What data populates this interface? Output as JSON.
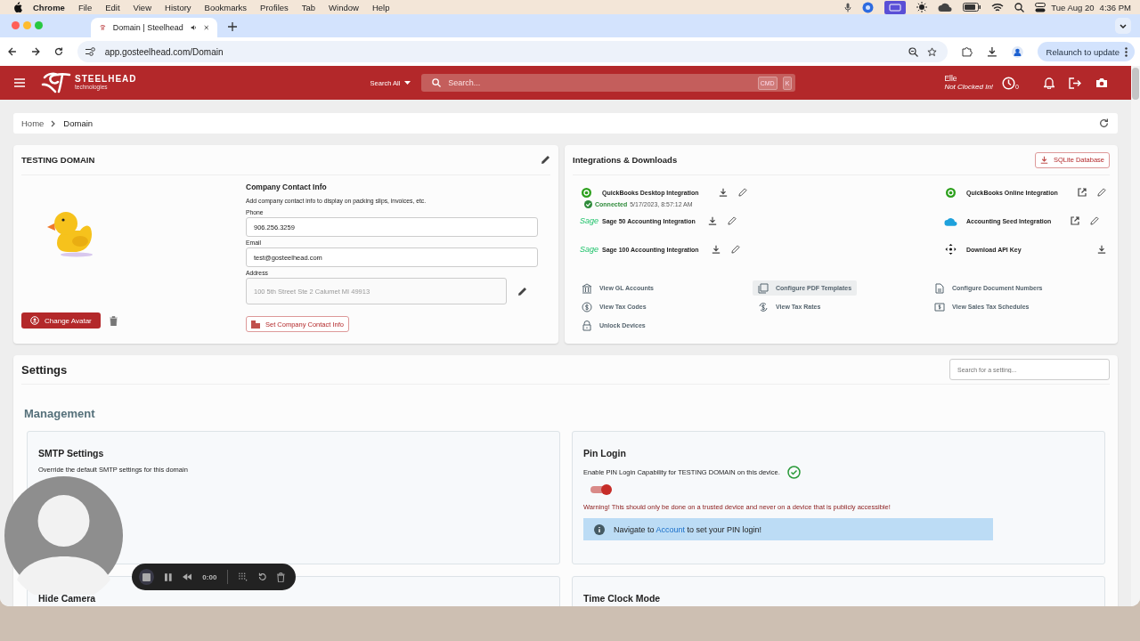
{
  "menu_bar": {
    "app": "Chrome",
    "items": [
      "File",
      "Edit",
      "View",
      "History",
      "Bookmarks",
      "Profiles",
      "Tab",
      "Window",
      "Help"
    ],
    "date": "Tue Aug 20",
    "time": "4:36 PM"
  },
  "browser": {
    "tab": {
      "title": "Domain | Steelhead"
    },
    "url": "app.gosteelhead.com/Domain",
    "relaunch": "Relaunch to update"
  },
  "header": {
    "brand": "STEELHEAD",
    "brand_sub": "technologies",
    "search_scope": "Search All",
    "search": {
      "placeholder": "Search..."
    },
    "shortcut": [
      "CMD",
      "K"
    ],
    "user": "Elle",
    "clock_status": "Not Clocked In!",
    "clock_count": "0"
  },
  "breadcrumb": [
    "Home",
    "Domain"
  ],
  "domain_card": {
    "title": "TESTING DOMAIN",
    "change_avatar": "Change Avatar",
    "contact": {
      "title": "Company Contact Info",
      "description": "Add company contact info to display on packing slips, invoices, etc.",
      "fields": [
        {
          "label": "Phone",
          "value": "906.256.3259",
          "disabled": false
        },
        {
          "label": "Email",
          "value": "test@gosteelhead.com",
          "disabled": false
        },
        {
          "label": "Address",
          "value": "100 5th Street Ste 2 Calumet MI 49913",
          "disabled": true
        }
      ],
      "button": "Set Company Contact Info"
    }
  },
  "integrations": {
    "title": "Integrations & Downloads",
    "download_button": "SQLite Database",
    "columns": [
      [
        {
          "kind": "desktop",
          "name": "QuickBooks Desktop Integration",
          "status": "Connected",
          "time": "5/17/2023, 8:57:12 AM"
        },
        {
          "kind": "sage",
          "logo_text": "Sage",
          "name": "Sage 50 Accounting Integration"
        },
        {
          "kind": "sage",
          "logo_text": "Sage",
          "name": "Sage 100 Accounting Integration"
        }
      ],
      [
        {
          "kind": "online",
          "name": "QuickBooks Online Integration"
        },
        {
          "kind": "cloud",
          "name": "Accounting Seed Integration"
        },
        {
          "kind": "apikey",
          "name": "Download API Key"
        }
      ]
    ],
    "links": [
      {
        "label": "View GL Accounts",
        "hovered": false
      },
      {
        "label": "Configure PDF Templates",
        "hovered": true
      },
      {
        "label": "Configure Document Numbers",
        "hovered": false
      },
      {
        "label": "View Tax Codes",
        "hovered": false
      },
      {
        "label": "View Tax Rates",
        "hovered": false
      },
      {
        "label": "View Sales Tax Schedules",
        "hovered": false
      },
      {
        "label": "Unlock Devices",
        "hovered": false
      }
    ]
  },
  "settings": {
    "title": "Settings",
    "search": {
      "placeholder": "Search for a setting..."
    },
    "section": "Management",
    "cards": [
      {
        "kind": "text",
        "title": "SMTP Settings",
        "description": "Override the default SMTP settings for this domain"
      },
      {
        "kind": "toggle",
        "title": "Pin Login",
        "description": "Enable PIN Login Capability for TESTING DOMAIN on this device.",
        "on": true,
        "warning": "Warning! This should only be done on a trusted device and never on a device that is publicly accessible!",
        "notice": {
          "before": "Navigate to",
          "link": "Account",
          "after": "to set your PIN login!"
        }
      },
      {
        "kind": "text",
        "title": "Hide Camera"
      },
      {
        "kind": "text",
        "title": "Time Clock Mode"
      }
    ]
  },
  "recorder": {
    "time": "0:00"
  }
}
